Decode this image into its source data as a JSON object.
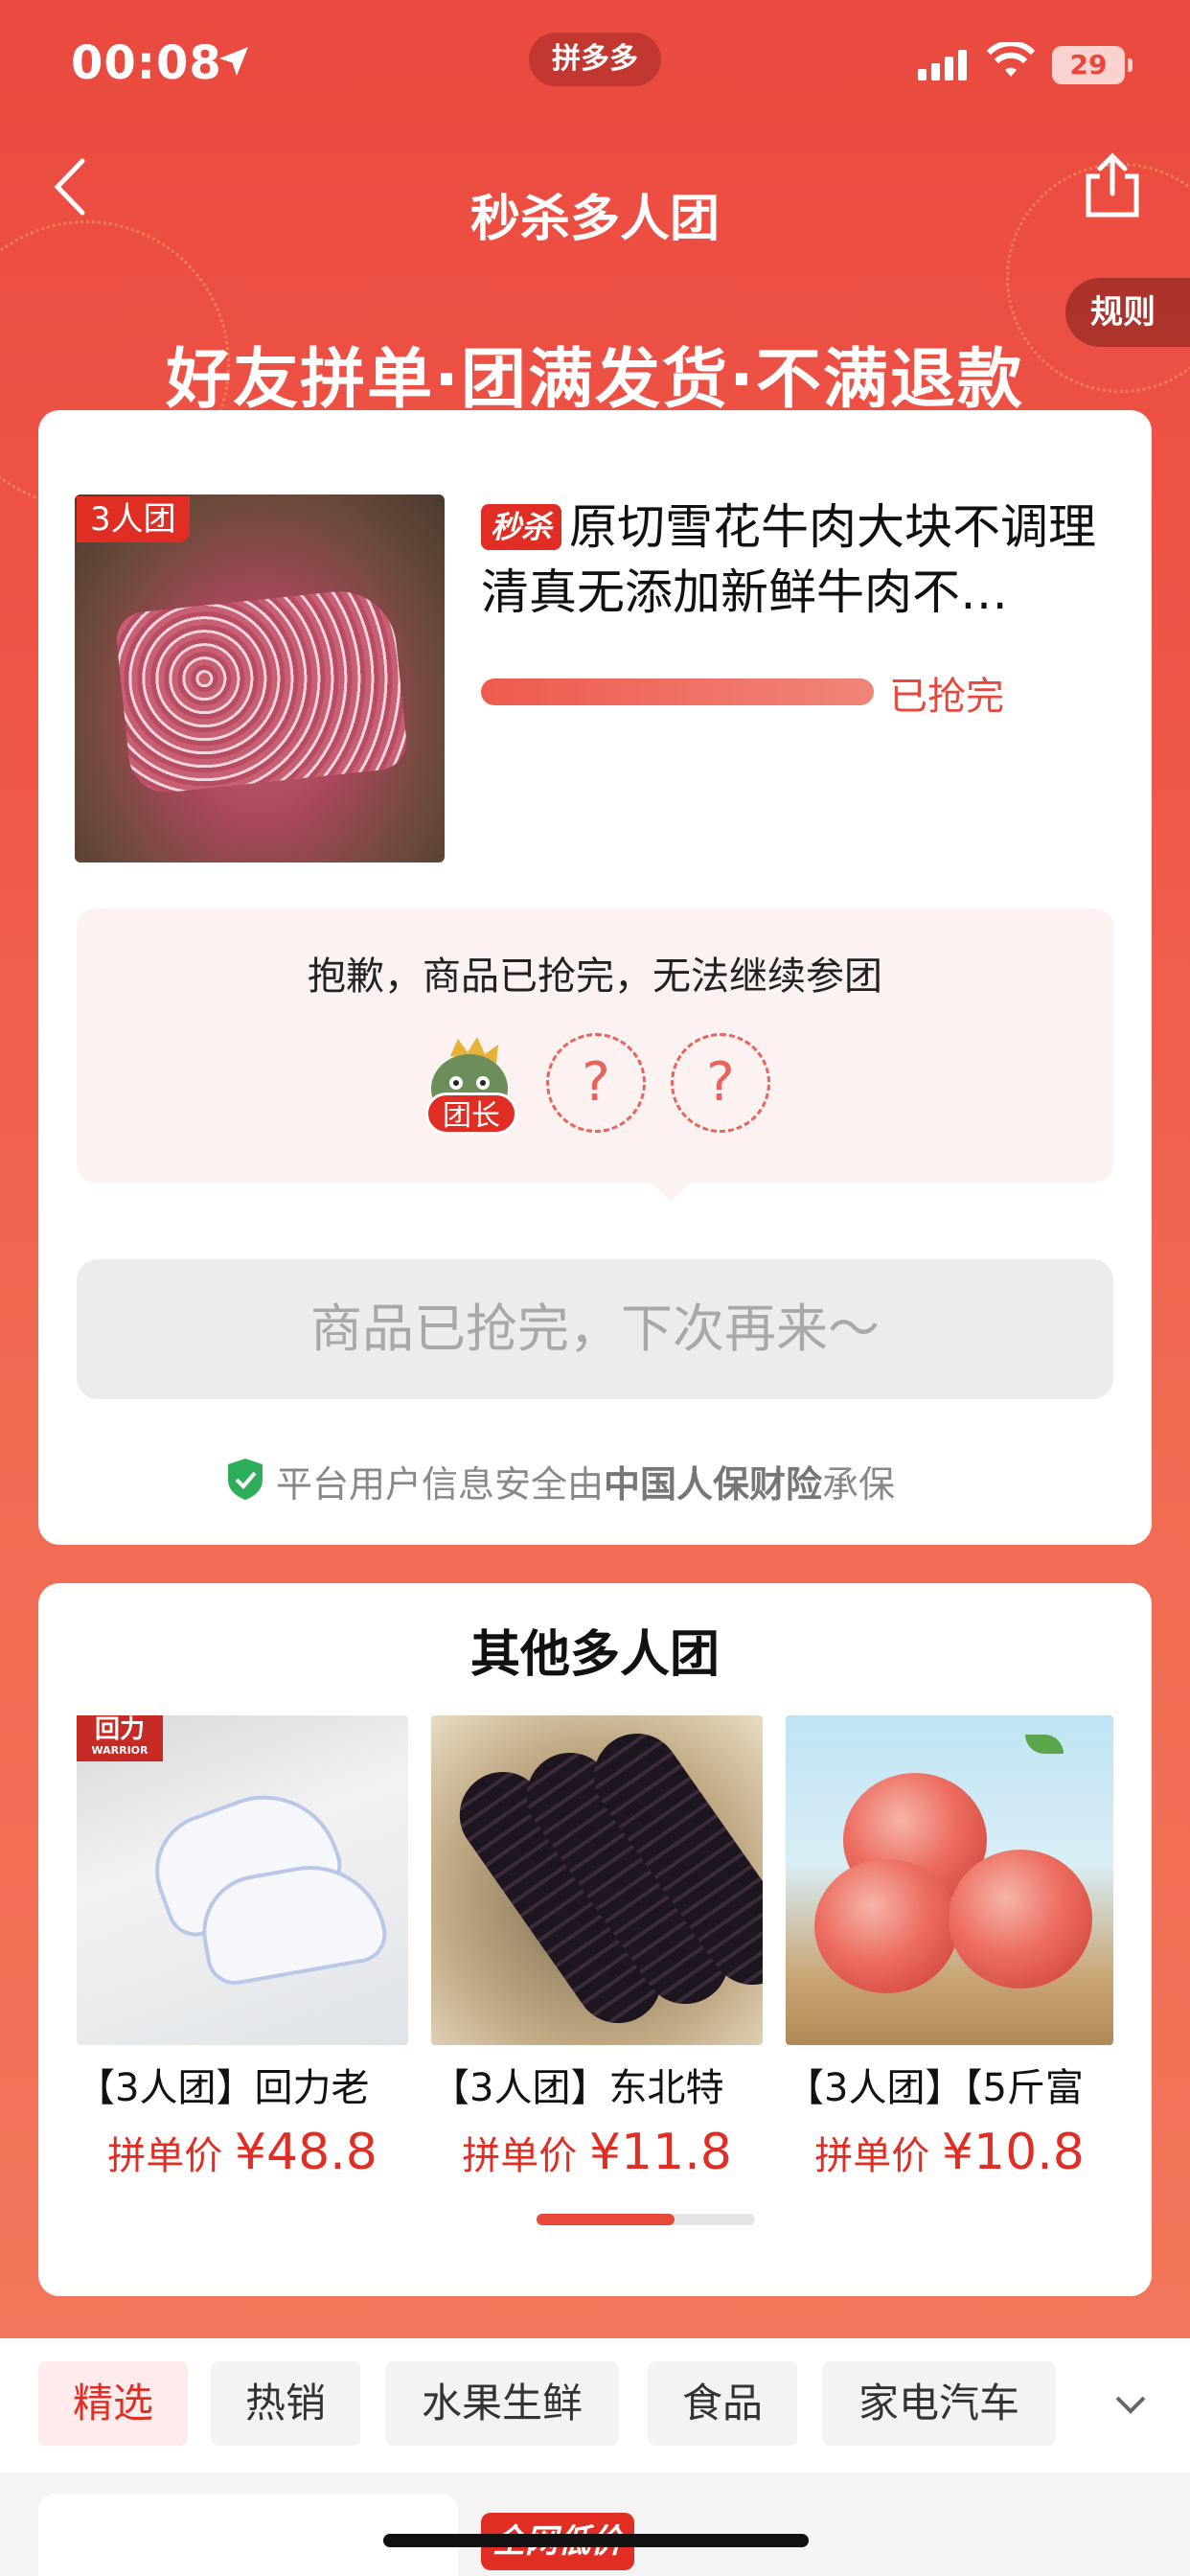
{
  "status_bar": {
    "time": "00:08",
    "app_label": "拼多多",
    "battery": "29"
  },
  "nav": {
    "title": "秒杀多人团"
  },
  "rule_label": "规则",
  "slogan": "好友拼单·团满发货·不满退款",
  "product": {
    "group_tag": "3人团",
    "badge": "秒杀",
    "title": "原切雪花牛肉大块不调理清真无添加新鲜牛肉不…",
    "progress": 1.0,
    "progress_status": "已抢完"
  },
  "group_status": {
    "message": "抱歉，商品已抢完，无法继续参团",
    "leader_label": "团长",
    "empty_slot": "?"
  },
  "main_button": "商品已抢完，下次再来～",
  "insurance": {
    "prefix": "平台用户信息安全由",
    "insurer": "中国人保财险",
    "suffix": "承保"
  },
  "other": {
    "title": "其他多人团",
    "items": [
      {
        "name": "【3人团】回力老",
        "price_label": "拼单价",
        "price": "¥48.8",
        "brand": "回力",
        "brand_sub": "WARRIOR"
      },
      {
        "name": "【3人团】东北特",
        "price_label": "拼单价",
        "price": "¥11.8"
      },
      {
        "name": "【3人团】【5斤富",
        "price_label": "拼单价",
        "price": "¥10.8"
      }
    ],
    "scroll_position": 0.63
  },
  "tabs": [
    "精选",
    "热销",
    "水果生鲜",
    "食品",
    "家电汽车"
  ],
  "bottom_badge": "全网低价",
  "colors": {
    "accent": "#e02e24",
    "bg_top": "#ea4a3f",
    "bg_bottom": "#f2765b"
  }
}
